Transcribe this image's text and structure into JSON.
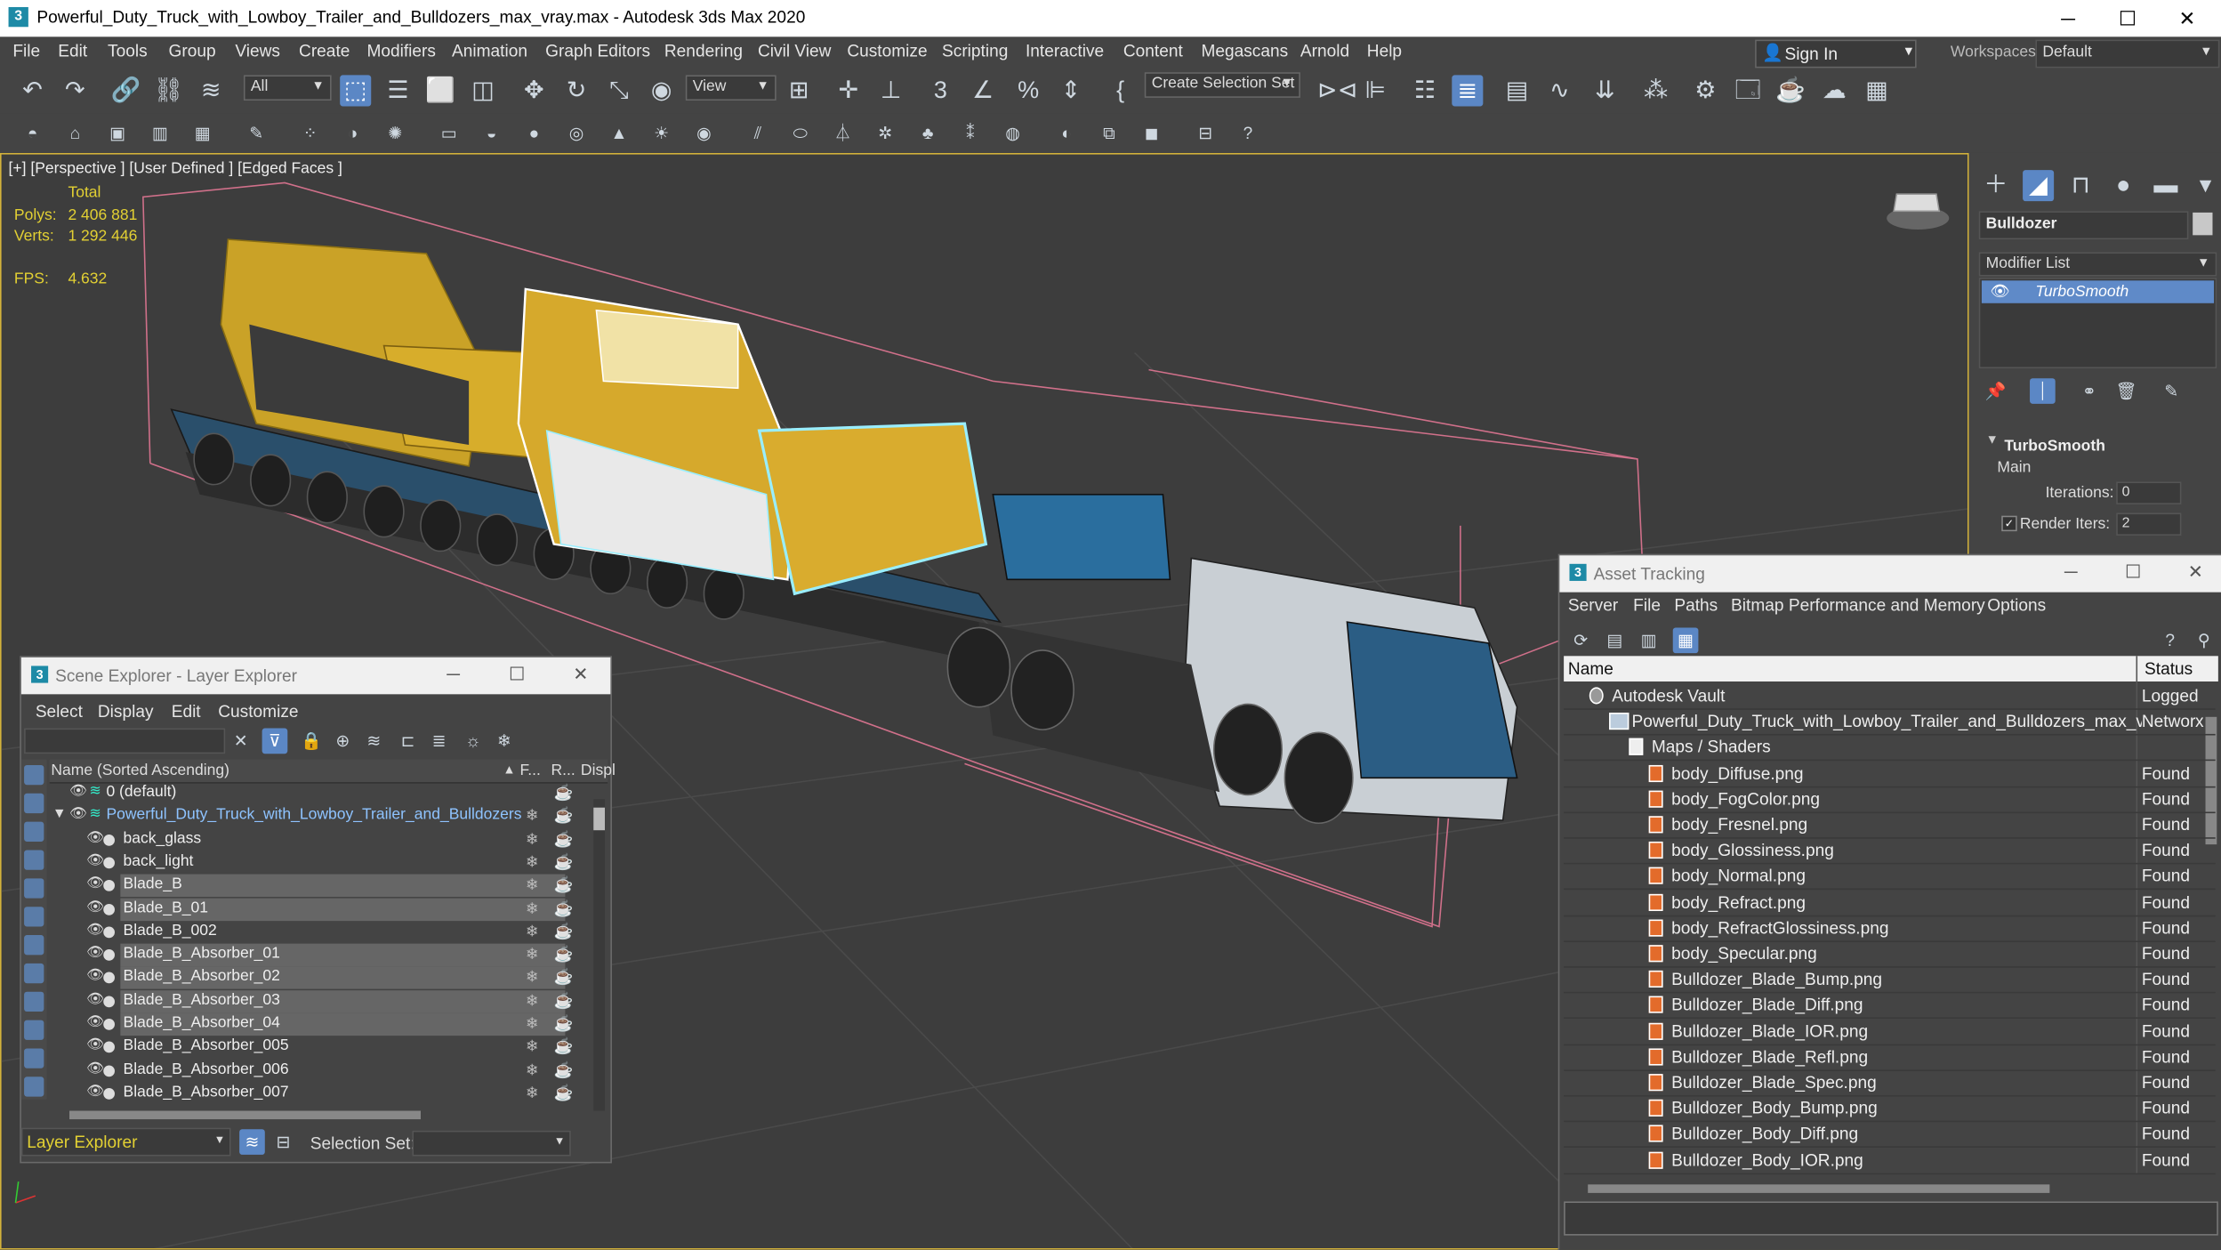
{
  "app": {
    "title": "Powerful_Duty_Truck_with_Lowboy_Trailer_and_Bulldozers_max_vray.max - Autodesk 3ds Max 2020",
    "icon_letter": "3",
    "window_buttons": [
      "─",
      "☐",
      "✕"
    ]
  },
  "menu": [
    "File",
    "Edit",
    "Tools",
    "Group",
    "Views",
    "Create",
    "Modifiers",
    "Animation",
    "Graph Editors",
    "Rendering",
    "Civil View",
    "Customize",
    "Scripting",
    "Interactive",
    "Content",
    "Megascans",
    "Arnold",
    "Help"
  ],
  "signin": {
    "label": "Sign In"
  },
  "workspaces": {
    "label": "Workspaces:",
    "value": "Default"
  },
  "toolbar": {
    "filter_value": "All",
    "view_value": "View",
    "selection_set": "Create Selection Set"
  },
  "viewport": {
    "label": "[+] [Perspective ] [User Defined ] [Edged Faces ]",
    "stats_header": "Total",
    "polys_label": "Polys:",
    "polys_value": "2 406 881",
    "verts_label": "Verts:",
    "verts_value": "1 292 446",
    "fps_label": "FPS:",
    "fps_value": "4.632"
  },
  "command_panel": {
    "object_name": "Bulldozer",
    "modifier_list": "Modifier List",
    "modifier": "TurboSmooth",
    "rollout": "TurboSmooth",
    "section": "Main",
    "iterations_label": "Iterations:",
    "iterations_value": "0",
    "render_iters_label": "Render Iters:",
    "render_iters_value": "2",
    "swatch_color": "#c8c8c8"
  },
  "scene_explorer": {
    "title": "Scene Explorer - Layer Explorer",
    "menu": [
      "Select",
      "Display",
      "Edit",
      "Customize"
    ],
    "col_name": "Name (Sorted Ascending)",
    "col_f": "F...",
    "col_r": "R...",
    "col_disp": "Displ",
    "rows": [
      {
        "label": "0 (default)",
        "level": 0,
        "highlight": false
      },
      {
        "label": "Powerful_Duty_Truck_with_Lowboy_Trailer_and_Bulldozers",
        "level": 0,
        "highlight": false,
        "blue": true
      },
      {
        "label": "back_glass",
        "level": 1,
        "highlight": false
      },
      {
        "label": "back_light",
        "level": 1,
        "highlight": false
      },
      {
        "label": "Blade_B",
        "level": 1,
        "highlight": true
      },
      {
        "label": "Blade_B_01",
        "level": 1,
        "highlight": true
      },
      {
        "label": "Blade_B_002",
        "level": 1,
        "highlight": false
      },
      {
        "label": "Blade_B_Absorber_01",
        "level": 1,
        "highlight": true
      },
      {
        "label": "Blade_B_Absorber_02",
        "level": 1,
        "highlight": true
      },
      {
        "label": "Blade_B_Absorber_03",
        "level": 1,
        "highlight": true
      },
      {
        "label": "Blade_B_Absorber_04",
        "level": 1,
        "highlight": true
      },
      {
        "label": "Blade_B_Absorber_005",
        "level": 1,
        "highlight": false
      },
      {
        "label": "Blade_B_Absorber_006",
        "level": 1,
        "highlight": false
      },
      {
        "label": "Blade_B_Absorber_007",
        "level": 1,
        "highlight": false
      }
    ],
    "footer_mode": "Layer Explorer",
    "selection_set_label": "Selection Set:"
  },
  "asset_tracking": {
    "title": "Asset Tracking",
    "menu": [
      "Server",
      "File",
      "Paths",
      "Bitmap Performance and Memory",
      "Options"
    ],
    "col_name": "Name",
    "col_status": "Status",
    "rows": [
      {
        "name": "Autodesk Vault",
        "status": "Logged",
        "indent": 0
      },
      {
        "name": "Powerful_Duty_Truck_with_Lowboy_Trailer_and_Bulldozers_max_vray.max",
        "status": "Networ",
        "indent": 1
      },
      {
        "name": "Maps / Shaders",
        "status": "",
        "indent": 2
      },
      {
        "name": "body_Diffuse.png",
        "status": "Found",
        "indent": 3
      },
      {
        "name": "body_FogColor.png",
        "status": "Found",
        "indent": 3
      },
      {
        "name": "body_Fresnel.png",
        "status": "Found",
        "indent": 3
      },
      {
        "name": "body_Glossiness.png",
        "status": "Found",
        "indent": 3
      },
      {
        "name": "body_Normal.png",
        "status": "Found",
        "indent": 3
      },
      {
        "name": "body_Refract.png",
        "status": "Found",
        "indent": 3
      },
      {
        "name": "body_RefractGlossiness.png",
        "status": "Found",
        "indent": 3
      },
      {
        "name": "body_Specular.png",
        "status": "Found",
        "indent": 3
      },
      {
        "name": "Bulldozer_Blade_Bump.png",
        "status": "Found",
        "indent": 3
      },
      {
        "name": "Bulldozer_Blade_Diff.png",
        "status": "Found",
        "indent": 3
      },
      {
        "name": "Bulldozer_Blade_IOR.png",
        "status": "Found",
        "indent": 3
      },
      {
        "name": "Bulldozer_Blade_Refl.png",
        "status": "Found",
        "indent": 3
      },
      {
        "name": "Bulldozer_Blade_Spec.png",
        "status": "Found",
        "indent": 3
      },
      {
        "name": "Bulldozer_Body_Bump.png",
        "status": "Found",
        "indent": 3
      },
      {
        "name": "Bulldozer_Body_Diff.png",
        "status": "Found",
        "indent": 3
      },
      {
        "name": "Bulldozer_Body_IOR.png",
        "status": "Found",
        "indent": 3
      }
    ]
  },
  "colors": {
    "accent": "#5b87c5",
    "viewport_border": "#d3b23b",
    "stats": "#e2d033",
    "selection": "#5f8ac8"
  }
}
